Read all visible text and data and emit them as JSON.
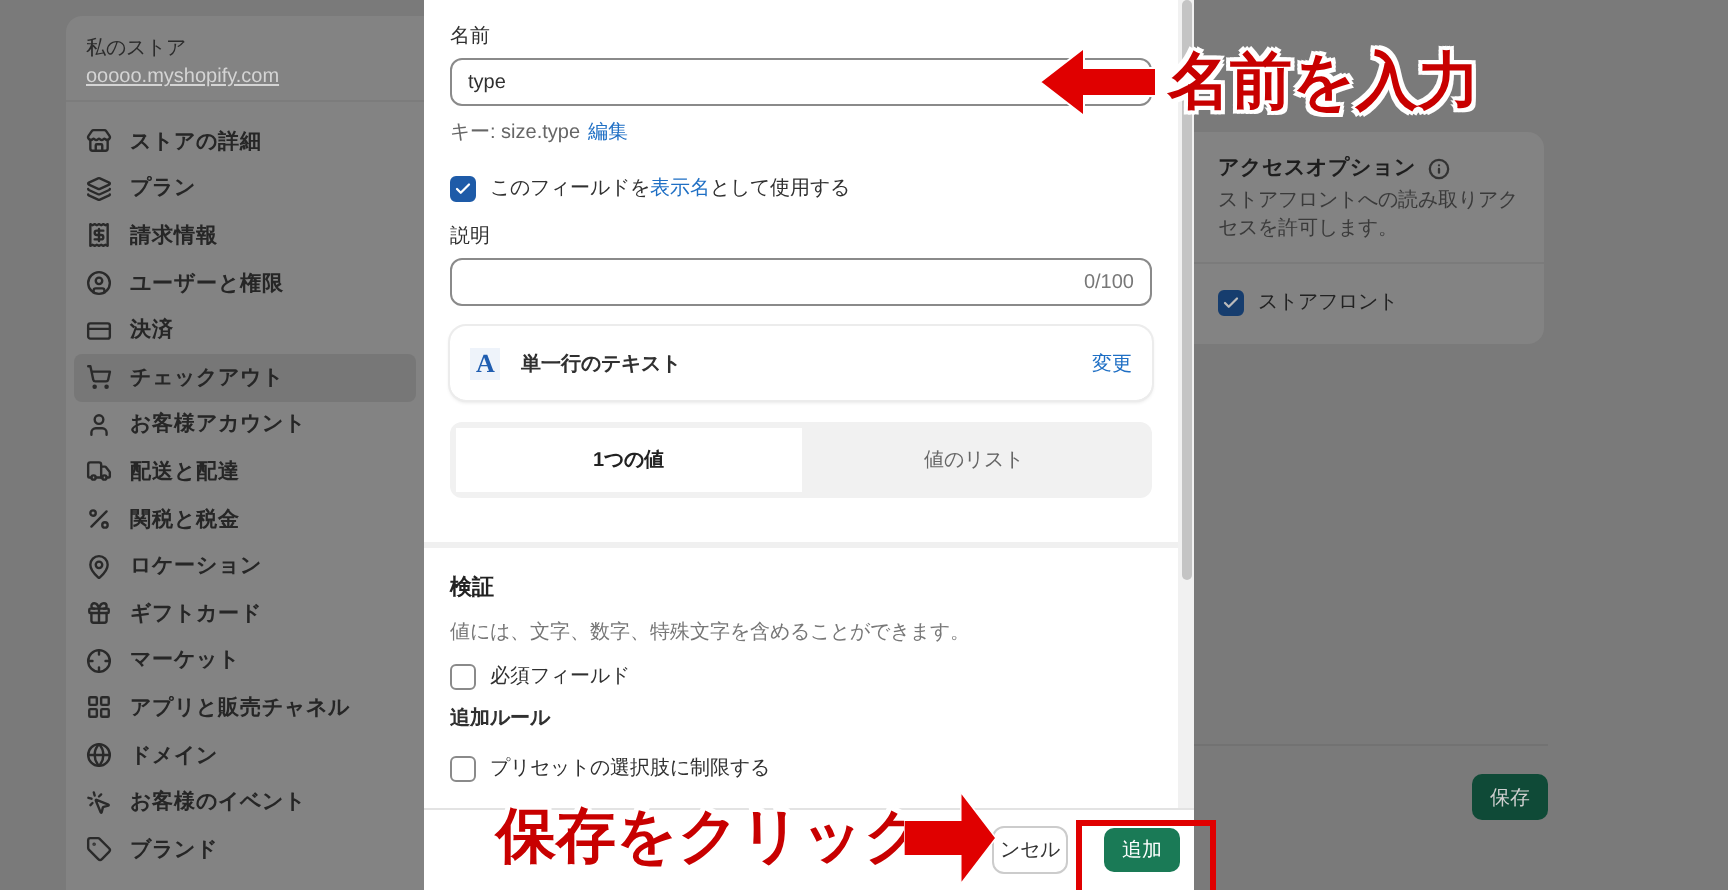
{
  "sidebar": {
    "store_name": "私のストア",
    "store_url": "ooooo.myshopify.com",
    "items": [
      {
        "label": "ストアの詳細",
        "selected": false
      },
      {
        "label": "プラン",
        "selected": false
      },
      {
        "label": "請求情報",
        "selected": false
      },
      {
        "label": "ユーザーと権限",
        "selected": false
      },
      {
        "label": "決済",
        "selected": false
      },
      {
        "label": "チェックアウト",
        "selected": true
      },
      {
        "label": "お客様アカウント",
        "selected": false
      },
      {
        "label": "配送と配達",
        "selected": false
      },
      {
        "label": "関税と税金",
        "selected": false
      },
      {
        "label": "ロケーション",
        "selected": false
      },
      {
        "label": "ギフトカード",
        "selected": false
      },
      {
        "label": "マーケット",
        "selected": false
      },
      {
        "label": "アプリと販売チャネル",
        "selected": false
      },
      {
        "label": "ドメイン",
        "selected": false
      },
      {
        "label": "お客様のイベント",
        "selected": false
      },
      {
        "label": "ブランド",
        "selected": false
      }
    ]
  },
  "modal": {
    "name_label": "名前",
    "name_value": "type",
    "key_text": "キー: size.type",
    "key_edit_link": "編集",
    "display_name_option": {
      "checked": true,
      "text_before": "このフィールドを",
      "link": "表示名",
      "text_after": "として使用する"
    },
    "description_label": "説明",
    "description_counter": "0/100",
    "type_card": {
      "icon_letter": "A",
      "label": "単一行のテキスト",
      "change_link": "変更"
    },
    "value_tabs": [
      {
        "label": "1つの値",
        "selected": true
      },
      {
        "label": "値のリスト",
        "selected": false
      }
    ],
    "validation": {
      "heading": "検証",
      "description": "値には、文字、数字、特殊文字を含めることができます。",
      "required": {
        "label": "必須フィールド",
        "checked": false
      },
      "rules_heading": "追加ルール",
      "rules": [
        {
          "label": "プリセットの選択肢に制限する",
          "checked": false
        }
      ]
    },
    "footer": {
      "cancel_button": "ンセル",
      "add_button": "追加"
    }
  },
  "access_card": {
    "title": "アクセスオプション",
    "description": "ストアフロントへの読み取りアクセスを許可します。",
    "option": {
      "label": "ストアフロント",
      "checked": true
    }
  },
  "save_button": "保存",
  "annotations": [
    {
      "text": "名前を入力"
    },
    {
      "text": "保存をクリック"
    }
  ]
}
